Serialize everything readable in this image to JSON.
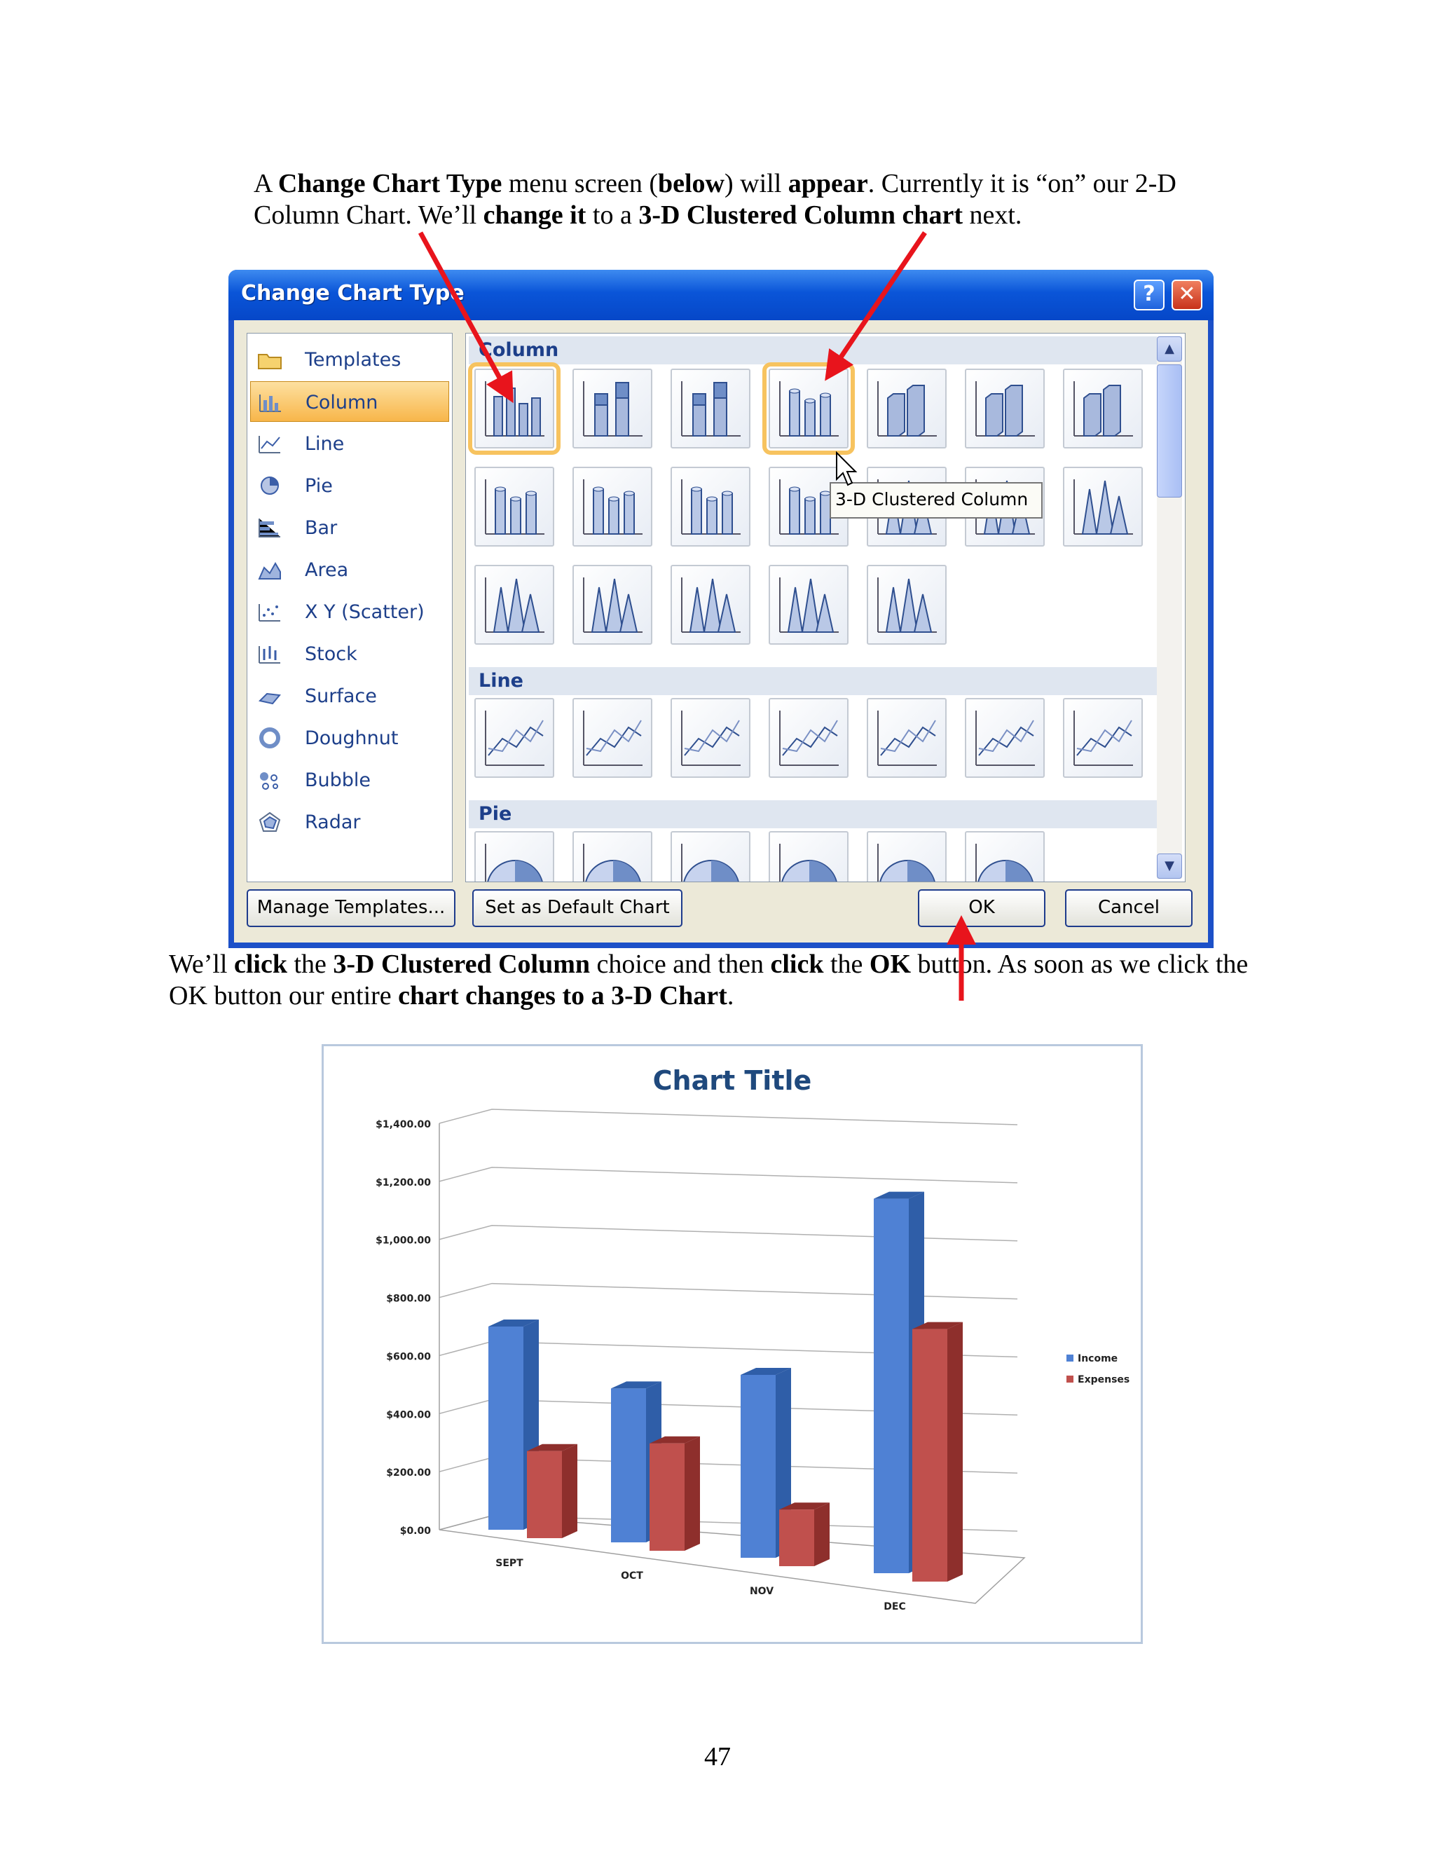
{
  "paragraph1": {
    "t1": "A ",
    "b1": "Change Chart Type",
    "t2": " menu screen (",
    "b2": "below",
    "t3": ") will ",
    "b3": "appear",
    "t4": ".  Currently it is “on” our 2-D Column Chart.  We’ll ",
    "b4": "change it",
    "t5": " to a ",
    "b5": "3-D Clustered Column chart",
    "t6": " next."
  },
  "dialog": {
    "title": "Change Chart Type",
    "help_label": "?",
    "close_label": "✕",
    "chart_types": [
      {
        "label": "Templates",
        "icon": "folder-icon"
      },
      {
        "label": "Column",
        "icon": "column-chart-icon",
        "selected": true
      },
      {
        "label": "Line",
        "icon": "line-chart-icon"
      },
      {
        "label": "Pie",
        "icon": "pie-chart-icon"
      },
      {
        "label": "Bar",
        "icon": "bar-chart-icon"
      },
      {
        "label": "Area",
        "icon": "area-chart-icon"
      },
      {
        "label": "X Y (Scatter)",
        "icon": "scatter-chart-icon"
      },
      {
        "label": "Stock",
        "icon": "stock-chart-icon"
      },
      {
        "label": "Surface",
        "icon": "surface-chart-icon"
      },
      {
        "label": "Doughnut",
        "icon": "doughnut-chart-icon"
      },
      {
        "label": "Bubble",
        "icon": "bubble-chart-icon"
      },
      {
        "label": "Radar",
        "icon": "radar-chart-icon"
      }
    ],
    "sections": {
      "column": "Column",
      "line": "Line",
      "pie": "Pie"
    },
    "tooltip": "3-D Clustered Column",
    "buttons": {
      "manage_templates": "Manage Templates...",
      "set_default": "Set as Default Chart",
      "ok": "OK",
      "cancel": "Cancel"
    },
    "colors": {
      "title_bar": "#0a55d8",
      "selection": "#f8b64a"
    }
  },
  "paragraph2": {
    "t1": "We’ll ",
    "b1": "click",
    "t2": " the ",
    "b2": "3-D Clustered Column",
    "t3": " choice and then ",
    "b3": "click",
    "t4": " the ",
    "b4": "OK",
    "t5": " button.  As soon as we click the OK button our entire ",
    "b5": "chart changes to a 3-D Chart",
    "t6": "."
  },
  "chart_data": {
    "type": "bar",
    "title": "Chart Title",
    "categories": [
      "SEPT",
      "OCT",
      "NOV",
      "DEC"
    ],
    "series": [
      {
        "name": "Income",
        "values": [
          700,
          530,
          630,
          1290
        ],
        "color": "#4f81d4"
      },
      {
        "name": "Expenses",
        "values": [
          300,
          370,
          195,
          870
        ],
        "color": "#c0504d"
      }
    ],
    "ylim": [
      0,
      1400
    ],
    "yticks": [
      "$0.00",
      "$200.00",
      "$400.00",
      "$600.00",
      "$800.00",
      "$1,000.00",
      "$1,200.00",
      "$1,400.00"
    ],
    "grid": true,
    "legend": "right"
  },
  "page_number": "47",
  "annotation_arrow_color": "#e8141c"
}
